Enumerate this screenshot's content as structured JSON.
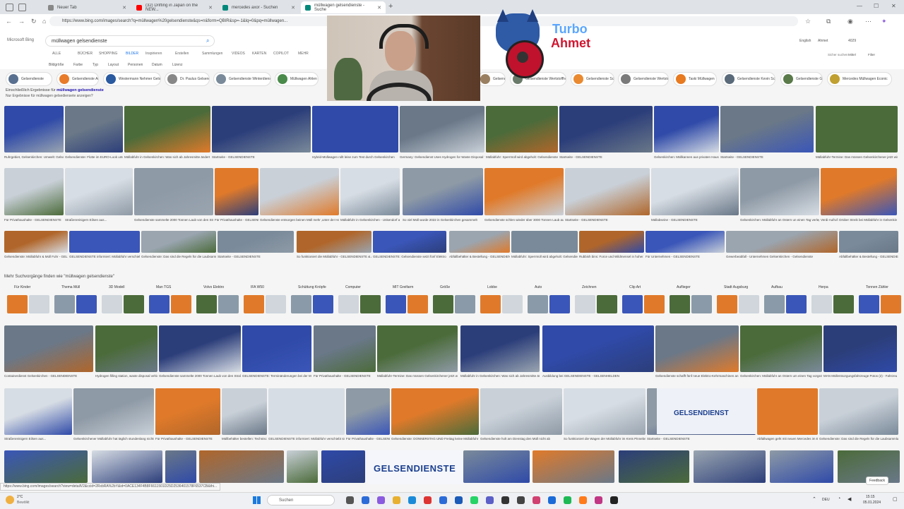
{
  "browser": {
    "tabs": [
      {
        "label": "Neuer Tab",
        "color": "#888888"
      },
      {
        "label": "(32) Drifting in Japan on the NEW...",
        "color": "#ff0000"
      },
      {
        "label": "mercedes axor - Suchen",
        "color": "#00897b"
      },
      {
        "label": "müllwagen gelsendienste - Suche",
        "color": "#00897b"
      }
    ],
    "url": "https://www.bing.com/images/search?q=müllwagen%20gelsendienste&qs=n&form=QBIR&sp=-1&lq=0&pq=müllwagen..."
  },
  "bing": {
    "logo": "Microsoft Bing",
    "query": "müllwagen gelsendienste",
    "tabs": [
      "ALLE",
      "BÜCHER",
      "SHOPPING",
      "BILDER",
      "Inspirieren",
      "Erstellen",
      "Sammlungen",
      "VIDEOS",
      "KARTEN",
      "COPILOT",
      "MEHR"
    ],
    "active_tab": "BILDER",
    "filters": [
      "Bildgröße",
      "Farbe",
      "Typ",
      "Layout",
      "Personen",
      "Datum",
      "Lizenz"
    ],
    "header_right": {
      "lang": "English",
      "user": "Ahmet",
      "points": "4029",
      "safesearch": "Sicher suchen",
      "mode": "Mittel",
      "filter": "Filter"
    },
    "results_note_prefix": "Einschließlich Ergebnisse für",
    "results_note_query": "müllwagen gelsendienste",
    "results_note_2": "Nur Ergebnisse für müllwagen gelsediensete anzeigen?",
    "chips": [
      {
        "label": "Gelsendienste",
        "color": "#5a7090"
      },
      {
        "label": "Gelsendienste Aufgaben",
        "color": "#e87c2a"
      },
      {
        "label": "Westermann Nehmer Gelsendienste",
        "color": "#2a5aa0"
      },
      {
        "label": "Dr. Paulus Gelsendienste",
        "color": "#888888"
      },
      {
        "label": "Gelsendienste Winterdienst",
        "color": "#7a8a9a"
      },
      {
        "label": "Müllwagen Ahlen Biomüll",
        "color": "#4a8a4a"
      },
      {
        "label": "Gelsendienste Stoffführung",
        "color": "#9a8060"
      },
      {
        "label": "Gelsendienste Wertstoffhof Nord",
        "color": "#6a7a6a"
      },
      {
        "label": "Gelsendienste Schutzkleidung",
        "color": "#ea8a30"
      },
      {
        "label": "Gelsendienste Wertstoffhof Kosten",
        "color": "#7a7a7a"
      },
      {
        "label": "Taski Müllwagen",
        "color": "#e87a20"
      },
      {
        "label": "Gelsendienste Kevin Schwelmus",
        "color": "#5a6a7a"
      },
      {
        "label": "Gelsendienste Gärtner",
        "color": "#5a7a4a"
      },
      {
        "label": "Mercedes Müllwagen Econic",
        "color": "#c0a030"
      }
    ],
    "captions_row1": [
      "Ruhrgebiet, Gelsenkirchen: Umwelt: Gelsendienste setzt erster...",
      "Gelsendienste: Flotte im EURO-Look unterwegs - Ra...",
      "Müllabfuhr in Gelsenkirchen: Was sich ab Jahresmitte ändert",
      "Startseite - GELSENDIENSTE",
      "Hybrid-Müllwagen rollt leise zum Test durch Gelsenkirchen",
      "Germany: Gelsendienst Uses Hydrogen for Waste Disposal Trucks",
      "Müllabfuhr: Sperrmüll wird abgeholt: Gelsendienste, Stadtwerke in...",
      "Startseite - GELSENDIENSTE",
      "Gelsenkirchen: Müllkannen aus privaten Haushalten entfernen und...",
      "Startseite - GELSENDIENSTE",
      "Müllabfuhr-Termine: Das müssen Gelsenkirchener jetzt wissen - WAZ News..."
    ],
    "captions_row2": [
      "Für Privathaushalte - GELSENDIENSTE",
      "Straßenreinigern Eilsen aus...",
      "Gelsendienste sammelte 2000 Tonnen Laub von den Straßen auf",
      "Für Privathaushalte - GELSENDIENSTE",
      "Gelsendienste entsorgen beinen Müll mehr ‚unter der Hand'",
      "Müllabfuhr in Gelsenkirchen - Unkendorf aktuell",
      "So viel Müll wurde 2022 in Gelsenkirchen gesammelt",
      "Gelsendienste schlen wieder über 3000 Tonnen Laub auflesen",
      "Startseite - GELSENDIENSTE",
      "Müllabseine - GELSENDIENSTE",
      "Gelsenkirchen: Müllabfuhr an Ostern un einen Tag verlegen",
      "Verdi-Aufruf: Drüber Streik bei Müllabfuhr in Gelsenkirchen"
    ],
    "captions_row3": [
      "Gelsendienste: Müllabfuhr & Müll Fuhr - GELSENDIENSTE",
      "GELSENDIENSTE informiert: Müllabfuhr verschiebt sich rund um Ostern",
      "Gelsendienste: Das sind die Regeln für die Laubsammlungen",
      "Startseite - GELSENDIENSTE",
      "So funktioniert die Müllabfuhr - GELSENDIENSTE & Abfuhr - Abfuhr...",
      "GELSENDIENSTE: Gelsendienste setzt fünf Elektro - Müllwagen in den...",
      "Abfallbehälter & Bestellung - GELSENDIENSTE",
      "Müllabfuhr: Sperrmüll wird abgeholt: Gelsendienste, Stadtwerke in...",
      "Rubbish bins: Force und Wildmensel in hoher Auflösung - Alamy",
      "Für Unternehmen - GELSENDIENSTE",
      "Gewerbeabfall - Unternehmen Gelsenkirchen - Gelsendienste",
      "Abfallbehälter & Bestellung - GELSENDIENSTE"
    ],
    "related_title": "Mehr Suchvorgänge finden wie \"müllwagen gelsendienste\"",
    "related": [
      "Für Kinder",
      "Thema Müll",
      "3D Modell",
      "Man TGS",
      "Volvo Elektro",
      "IFA W50",
      "Schüttung Knöpfe",
      "Computer",
      "MIT Greifarm",
      "Größe",
      "Lobbe",
      "Auto",
      "Zeichnen",
      "Clip Art",
      "Auflieger",
      "Stadt Augsburg",
      "Aufbau",
      "Herpa",
      "Tonnen Zähler"
    ],
    "captions_row4": [
      "Containerdienst Gelsenkirchen - GELSENDIENSTE",
      "Hydrogen filling station, waste disposal vehicle, refuse collection",
      "Gelsendienste sammelte 2000 Tonnen Laub von den Straßen auf",
      "GELSENDIENSTE: Terminänderungen bei der Müllabfuhr zum Weihnachten",
      "Für Privathaushalte - GELSENDIENSTE",
      "Müllabfuhr-Termine: Das müssen Gelsenkirchener jetzt wissen",
      "Müllabfuhr in Gelsenkirchen: Was sich ab Jahresmitte ändert",
      "Ausbildung bei GELSENDIENSTE - GELSENHELDEN",
      "Gelsendienste schafft fünf neue Elektro-Kehrmaschinen an",
      "Gelsenkirchen: Müllabfuhr an Ostern um einen Tag vorgezogen",
      "MAN Müllentsorgungsfahrzeuge Potos (2) - Fahrzeugbilder.de"
    ],
    "captions_row5": [
      "Straßenreinigern Eilsen aus...",
      "Gelsenkirchener Müllabfuhr hat täglich stundenlang nichts zu tun",
      "Für Privathaushalte - GELSENDIENSTE",
      "Müllbehälter bestellen: Technische Betriebs-Rhede",
      "GELSENDIENSTE informiert: Müllabfuhr verschiebt sich rund um Ostern",
      "Für Privathaushalte - GELSENDIENSTE",
      "Gelsendienste: DONNERSTAG UND Freitag keine Müllabfuhr - Gelsendienste",
      "Gelsendienste holt am Dienstag den Müll nicht ab",
      "So funktioniert die Wagen der Müllabfuhr im Kreis Pinneberg",
      "Startseite - GELSENDIENSTE",
      "Abfallwagen geht mit neuen Mercedes im Einsatz am 13 April 2...",
      "Gelsendienste: Das sind die Regeln für die Laubsammlungen"
    ],
    "brand_banner": "GELSENDIENSTE",
    "brand_banner_2": "GELSENDIENST",
    "status_url": "https://www.bing.com/images/search?view=detailV2&ccid=2RxbRA%2bY&id=0ACE134F4B8F6611501D25D2536401578F6537CB&thi...",
    "feedback": "Feedback"
  },
  "overlay": {
    "logo_line1": "Turbo",
    "logo_line2": "Ahmet"
  },
  "taskbar": {
    "weather_temp": "2°C",
    "weather_desc": "Bewölkt",
    "search": "Suchen",
    "lang": "DEU",
    "time": "15:15",
    "date": "05.01.2024"
  }
}
